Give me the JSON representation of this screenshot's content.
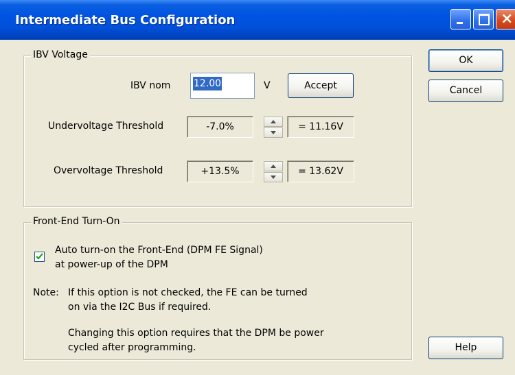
{
  "window": {
    "title": "Intermediate Bus Configuration",
    "controls": {
      "minimize": "minimize",
      "maximize": "maximize",
      "close": "×"
    }
  },
  "ibv_voltage": {
    "legend": "IBV Voltage",
    "nom_label": "IBV nom",
    "nom_value": "12.00",
    "unit": "V",
    "accept_label": "Accept",
    "under_label": "Undervoltage Threshold",
    "under_pct": "-7.0%",
    "under_result": "= 11.16V",
    "over_label": "Overvoltage Threshold",
    "over_pct": "+13.5%",
    "over_result": "= 13.62V"
  },
  "front_end": {
    "legend": "Front-End Turn-On",
    "auto_checked": true,
    "auto_line1": "Auto turn-on the Front-End (DPM FE Signal)",
    "auto_line2": "at power-up of the DPM",
    "note_prefix": "Note:",
    "note_line1": "If this option is not checked, the FE can be turned",
    "note_line2": "on via the I2C Bus if required.",
    "change_line1": "Changing this option requires that the DPM be power",
    "change_line2": "cycled after programming."
  },
  "buttons": {
    "ok": "OK",
    "cancel": "Cancel",
    "help": "Help"
  }
}
